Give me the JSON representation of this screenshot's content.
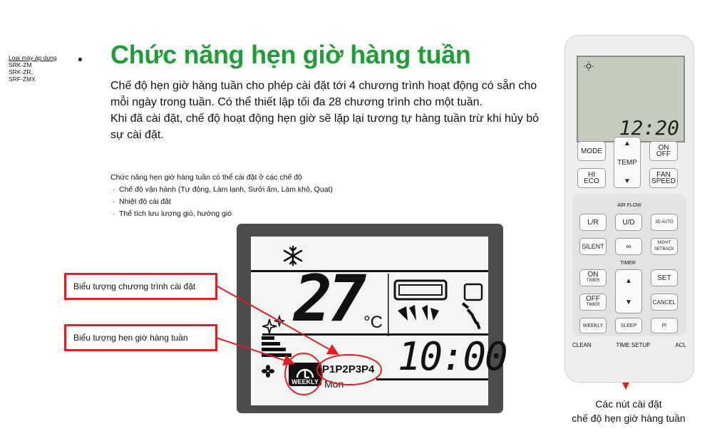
{
  "models": {
    "title": "Loại máy áp dụng",
    "items": [
      "SRK-ZM",
      "SRK-ZR,",
      "SRF-ZMX"
    ]
  },
  "heading": "Chức năng hẹn giờ hàng tuần",
  "intro": [
    "Chế độ hẹn giờ hàng tuần cho phép cài đặt tới 4 chương trình hoạt động có sẵn cho mỗi ngày trong tuần. Có thể thiết lập tối đa 28 chương trình cho một tuần.",
    "Khi đã cài đặt, chế độ hoạt động hẹn giờ sẽ lặp lại tương tự hàng tuần trừ khi hủy bỏ sự cài đặt."
  ],
  "modes": {
    "title": "Chức năng hẹn giờ hàng tuần có thể cài đặt ở các chế độ",
    "items": [
      "Chế độ vận hành (Tự động, Làm lạnh, Sưởi ấm, Làm khô, Quạt)",
      "Nhiệt độ cài đặt",
      "Thể tích lưu lượng gió, hướng gió"
    ]
  },
  "lcd": {
    "temperature": "27",
    "unit": "°C",
    "time": "10:00",
    "programs": "P1P2P3P4",
    "day": "Mon",
    "weekly_label": "WEEKLY"
  },
  "callouts": {
    "program_icon": "Biểu tượng chương trình cài đặt",
    "weekly_icon": "Biểu tượng hẹn giờ hàng tuần"
  },
  "remote": {
    "lcd_time": "12:20",
    "buttons": {
      "mode": "MODE",
      "temp": "TEMP",
      "on_off_1": "ON",
      "on_off_2": "OFF",
      "hi_eco_1": "HI",
      "hi_eco_2": "ECO",
      "fan_speed_1": "FAN",
      "fan_speed_2": "SPEED",
      "airflow": "AIR FLOW",
      "lr": "L/R",
      "ud": "U/D",
      "auto3d": "3D AUTO",
      "silent": "SILENT",
      "night_1": "NIGHT",
      "night_2": "SETBACK",
      "timer": "TIMER",
      "on_timer_1": "ON",
      "on_timer_2": "TIMER",
      "off_timer_1": "OFF",
      "off_timer_2": "TIMER",
      "set": "SET",
      "cancel": "CANCEL",
      "weekly": "WEEKLY",
      "sleep": "SLEEP",
      "p": "P/"
    },
    "bottom_labels": [
      "CLEAN",
      "TIME SETUP",
      "ACL"
    ]
  },
  "remote_caption": [
    "Các nút cài đặt",
    "chế độ hẹn giờ hàng tuần"
  ],
  "colors": {
    "heading": "#1f9e35",
    "callout": "#e02020",
    "lcd_frame": "#4c4c4c"
  },
  "icons": [
    "snowflake-icon",
    "sparkle-icon",
    "fan-icon",
    "indoor-unit-icon",
    "airflow-louver-icon",
    "clock-icon",
    "sun-icon",
    "arrow-up-icon",
    "arrow-down-icon"
  ]
}
